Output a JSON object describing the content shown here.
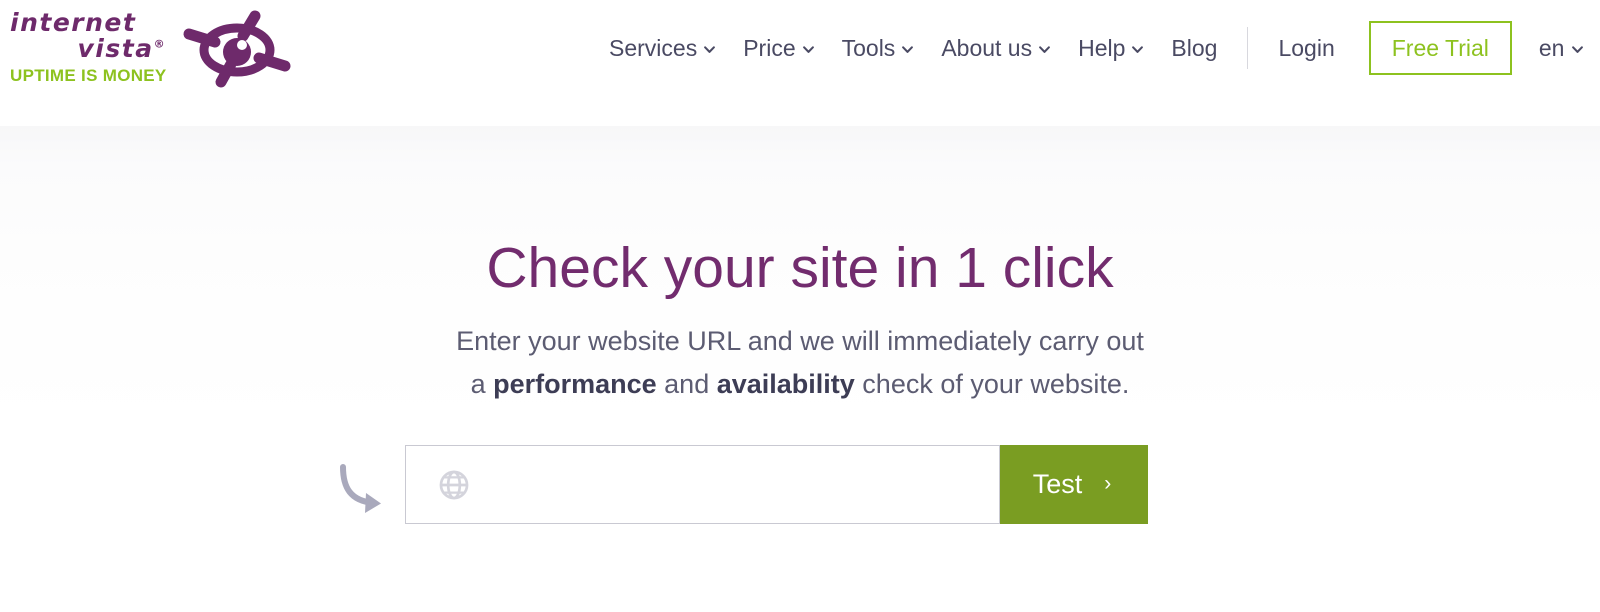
{
  "brand": {
    "logo_line1": "internet",
    "logo_line2": "vista",
    "logo_registered": "®",
    "logo_tagline": "UPTIME IS MONEY",
    "logo_icon": "eye-icon",
    "purple": "#6e2a6b",
    "green": "#8dc21f"
  },
  "nav": {
    "items": [
      {
        "label": "Services",
        "has_dropdown": true,
        "icon": "chevron-down-icon"
      },
      {
        "label": "Price",
        "has_dropdown": true,
        "icon": "chevron-down-icon"
      },
      {
        "label": "Tools",
        "has_dropdown": true,
        "icon": "chevron-down-icon"
      },
      {
        "label": "About us",
        "has_dropdown": true,
        "icon": "chevron-down-icon"
      },
      {
        "label": "Help",
        "has_dropdown": true,
        "icon": "chevron-down-icon"
      },
      {
        "label": "Blog",
        "has_dropdown": false,
        "icon": ""
      }
    ],
    "login_label": "Login",
    "free_trial_label": "Free Trial",
    "language": {
      "selected": "en",
      "icon": "chevron-down-icon"
    }
  },
  "hero": {
    "title": "Check your site in 1 click",
    "subtitle_line1": "Enter your website URL and we will immediately carry out",
    "subtitle_line2_a": "a ",
    "subtitle_line2_bold1": "performance",
    "subtitle_line2_b": " and ",
    "subtitle_line2_bold2": "availability",
    "subtitle_line2_c": " check of your website."
  },
  "search": {
    "placeholder": "",
    "value": "",
    "icon": "globe-icon",
    "hint_icon": "curved-arrow-icon",
    "button_label": "Test",
    "button_icon": "chevron-right-icon",
    "button_color": "#7a9d22"
  }
}
